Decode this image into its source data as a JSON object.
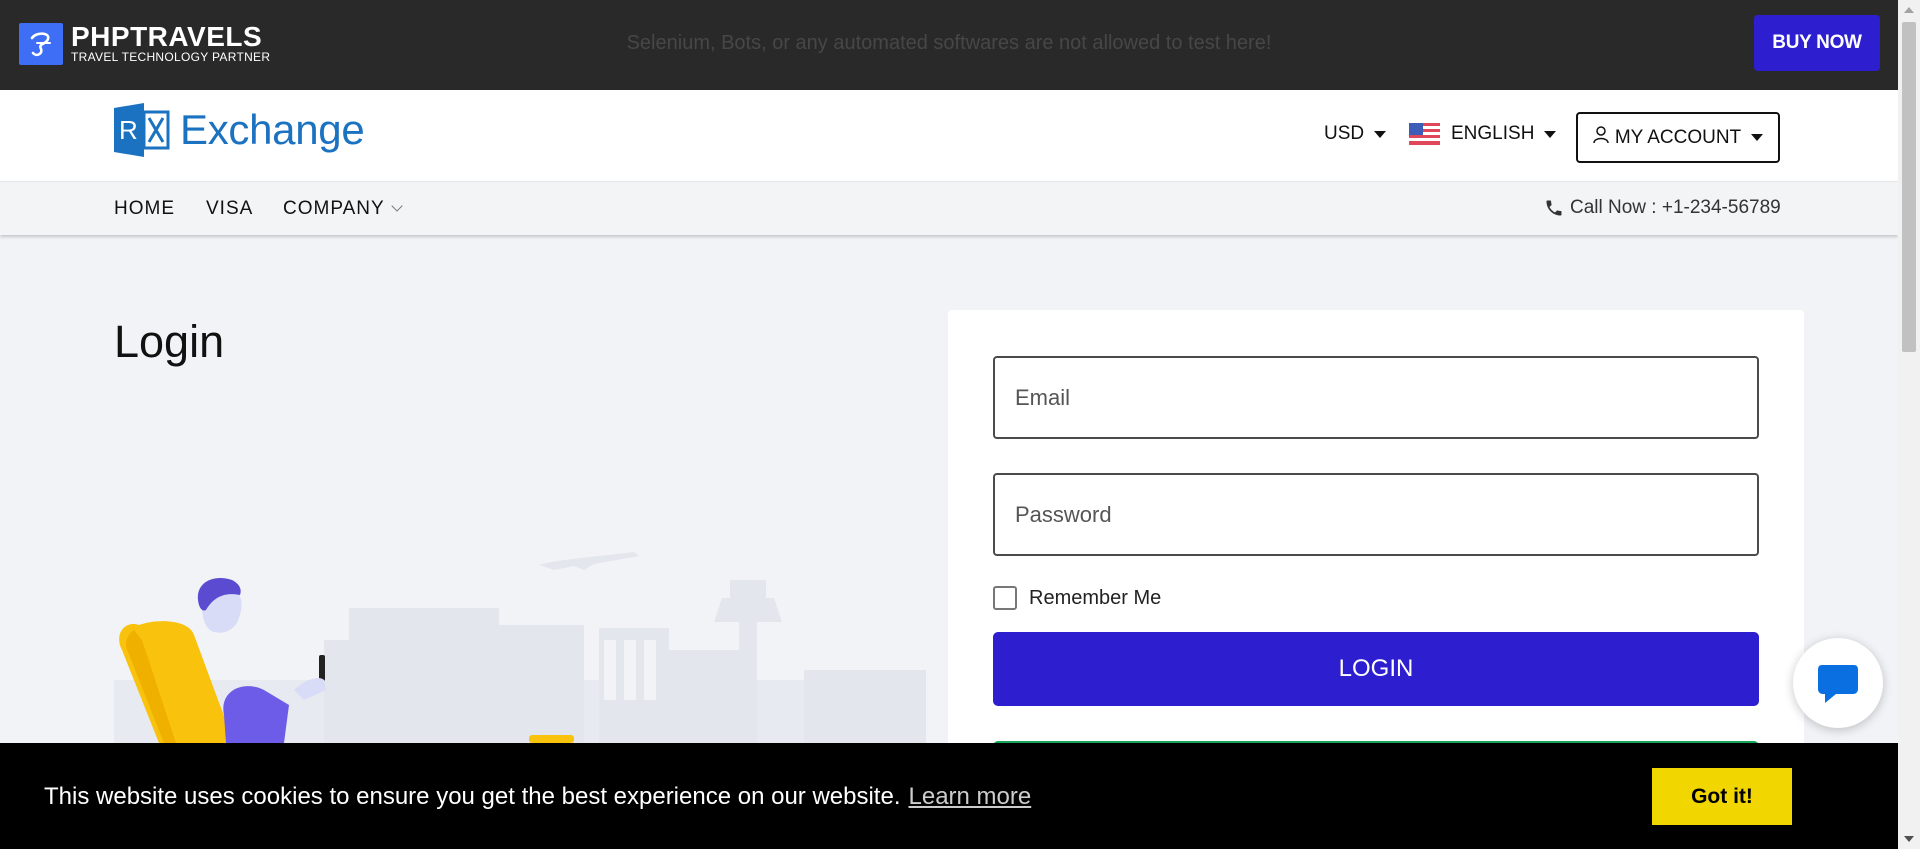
{
  "topbar": {
    "brand_name": "PHPTRAVELS",
    "brand_tagline": "TRAVEL TECHNOLOGY PARTNER",
    "warning": "Selenium, Bots, or any automated softwares are not allowed to test here!",
    "buy_now": "BUY NOW"
  },
  "header": {
    "logo_text": "Exchange",
    "currency": "USD",
    "language": "ENGLISH",
    "account": "MY ACCOUNT"
  },
  "nav": {
    "items": [
      "HOME",
      "VISA",
      "COMPANY"
    ],
    "call": "Call Now : +1-234-56789"
  },
  "page": {
    "title": "Login"
  },
  "form": {
    "email_placeholder": "Email",
    "password_placeholder": "Password",
    "remember_label": "Remember Me",
    "login_label": "LOGIN"
  },
  "cookie": {
    "message": "This website uses cookies to ensure you get the best experience on our website.",
    "learn_more": "Learn more",
    "accept": "Got it!"
  },
  "colors": {
    "brand_blue": "#2d1fd0",
    "logo_blue": "#1b72c0",
    "topbar": "#292929",
    "cookie_button": "#f1d600",
    "signup_green": "#18a35a"
  }
}
